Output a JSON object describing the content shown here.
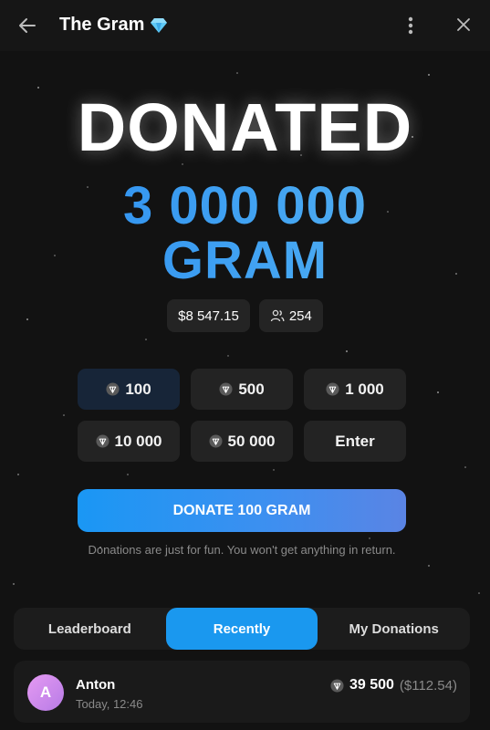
{
  "window": {
    "title": "The Gram"
  },
  "hero": {
    "headline": "DONATED",
    "amount_line1": "3 000 000",
    "amount_line2": "GRAM"
  },
  "stats": {
    "usd_total": "$8 547.15",
    "donors_count": "254"
  },
  "amount_options": [
    {
      "label": "100",
      "selected": true,
      "has_icon": true
    },
    {
      "label": "500",
      "selected": false,
      "has_icon": true
    },
    {
      "label": "1 000",
      "selected": false,
      "has_icon": true
    },
    {
      "label": "10 000",
      "selected": false,
      "has_icon": true
    },
    {
      "label": "50 000",
      "selected": false,
      "has_icon": true
    },
    {
      "label": "Enter",
      "selected": false,
      "has_icon": false
    }
  ],
  "donate_button": {
    "label": "DONATE 100 GRAM"
  },
  "note": "Donations are just for fun. You won't get anything in return.",
  "tabs": [
    {
      "label": "Leaderboard",
      "active": false
    },
    {
      "label": "Recently",
      "active": true
    },
    {
      "label": "My Donations",
      "active": false
    }
  ],
  "donations": [
    {
      "avatar_letter": "A",
      "name": "Anton",
      "time": "Today, 12:46",
      "amount": "39 500",
      "usd": "($112.54)"
    }
  ],
  "colors": {
    "background": "#121212",
    "accent": "#1a98ef",
    "amount_gradient_start": "#2a8cf0",
    "amount_gradient_end": "#5fb5ee",
    "selected_option_bg": "#172538"
  },
  "icons": {
    "back": "arrow-left-icon",
    "verified": "diamond-icon",
    "menu": "more-vertical-icon",
    "close": "close-icon",
    "donors": "users-icon",
    "currency": "gram-gem-icon"
  }
}
